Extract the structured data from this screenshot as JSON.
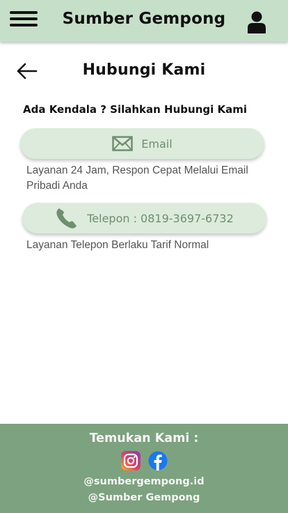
{
  "header": {
    "title": "Sumber Gempong",
    "menu_icon": "hamburger-icon",
    "account_icon": "user-icon",
    "color": "#c6dfc9"
  },
  "page": {
    "back_icon": "arrow-left-icon",
    "title": "Hubungi Kami",
    "prompt": "Ada Kendala ? Silahkan Hubungi Kami"
  },
  "contacts": {
    "email": {
      "label": "Email",
      "icon": "envelope-icon",
      "description": "Layanan 24 Jam, Respon Cepat Melalui Email Pribadi Anda"
    },
    "phone": {
      "label": "Telepon : 0819-3697-6732",
      "icon": "phone-icon",
      "description": "Layanan Telepon Berlaku Tarif Normal"
    },
    "button_color": "#dcebdc",
    "accent": "#6f8f70"
  },
  "footer": {
    "title": "Temukan Kami :",
    "instagram_icon": "instagram-icon",
    "facebook_icon": "facebook-icon",
    "instagram_handle": "@sumbergempong.id",
    "facebook_handle": "@Sumber Gempong",
    "color": "#7da27f"
  }
}
